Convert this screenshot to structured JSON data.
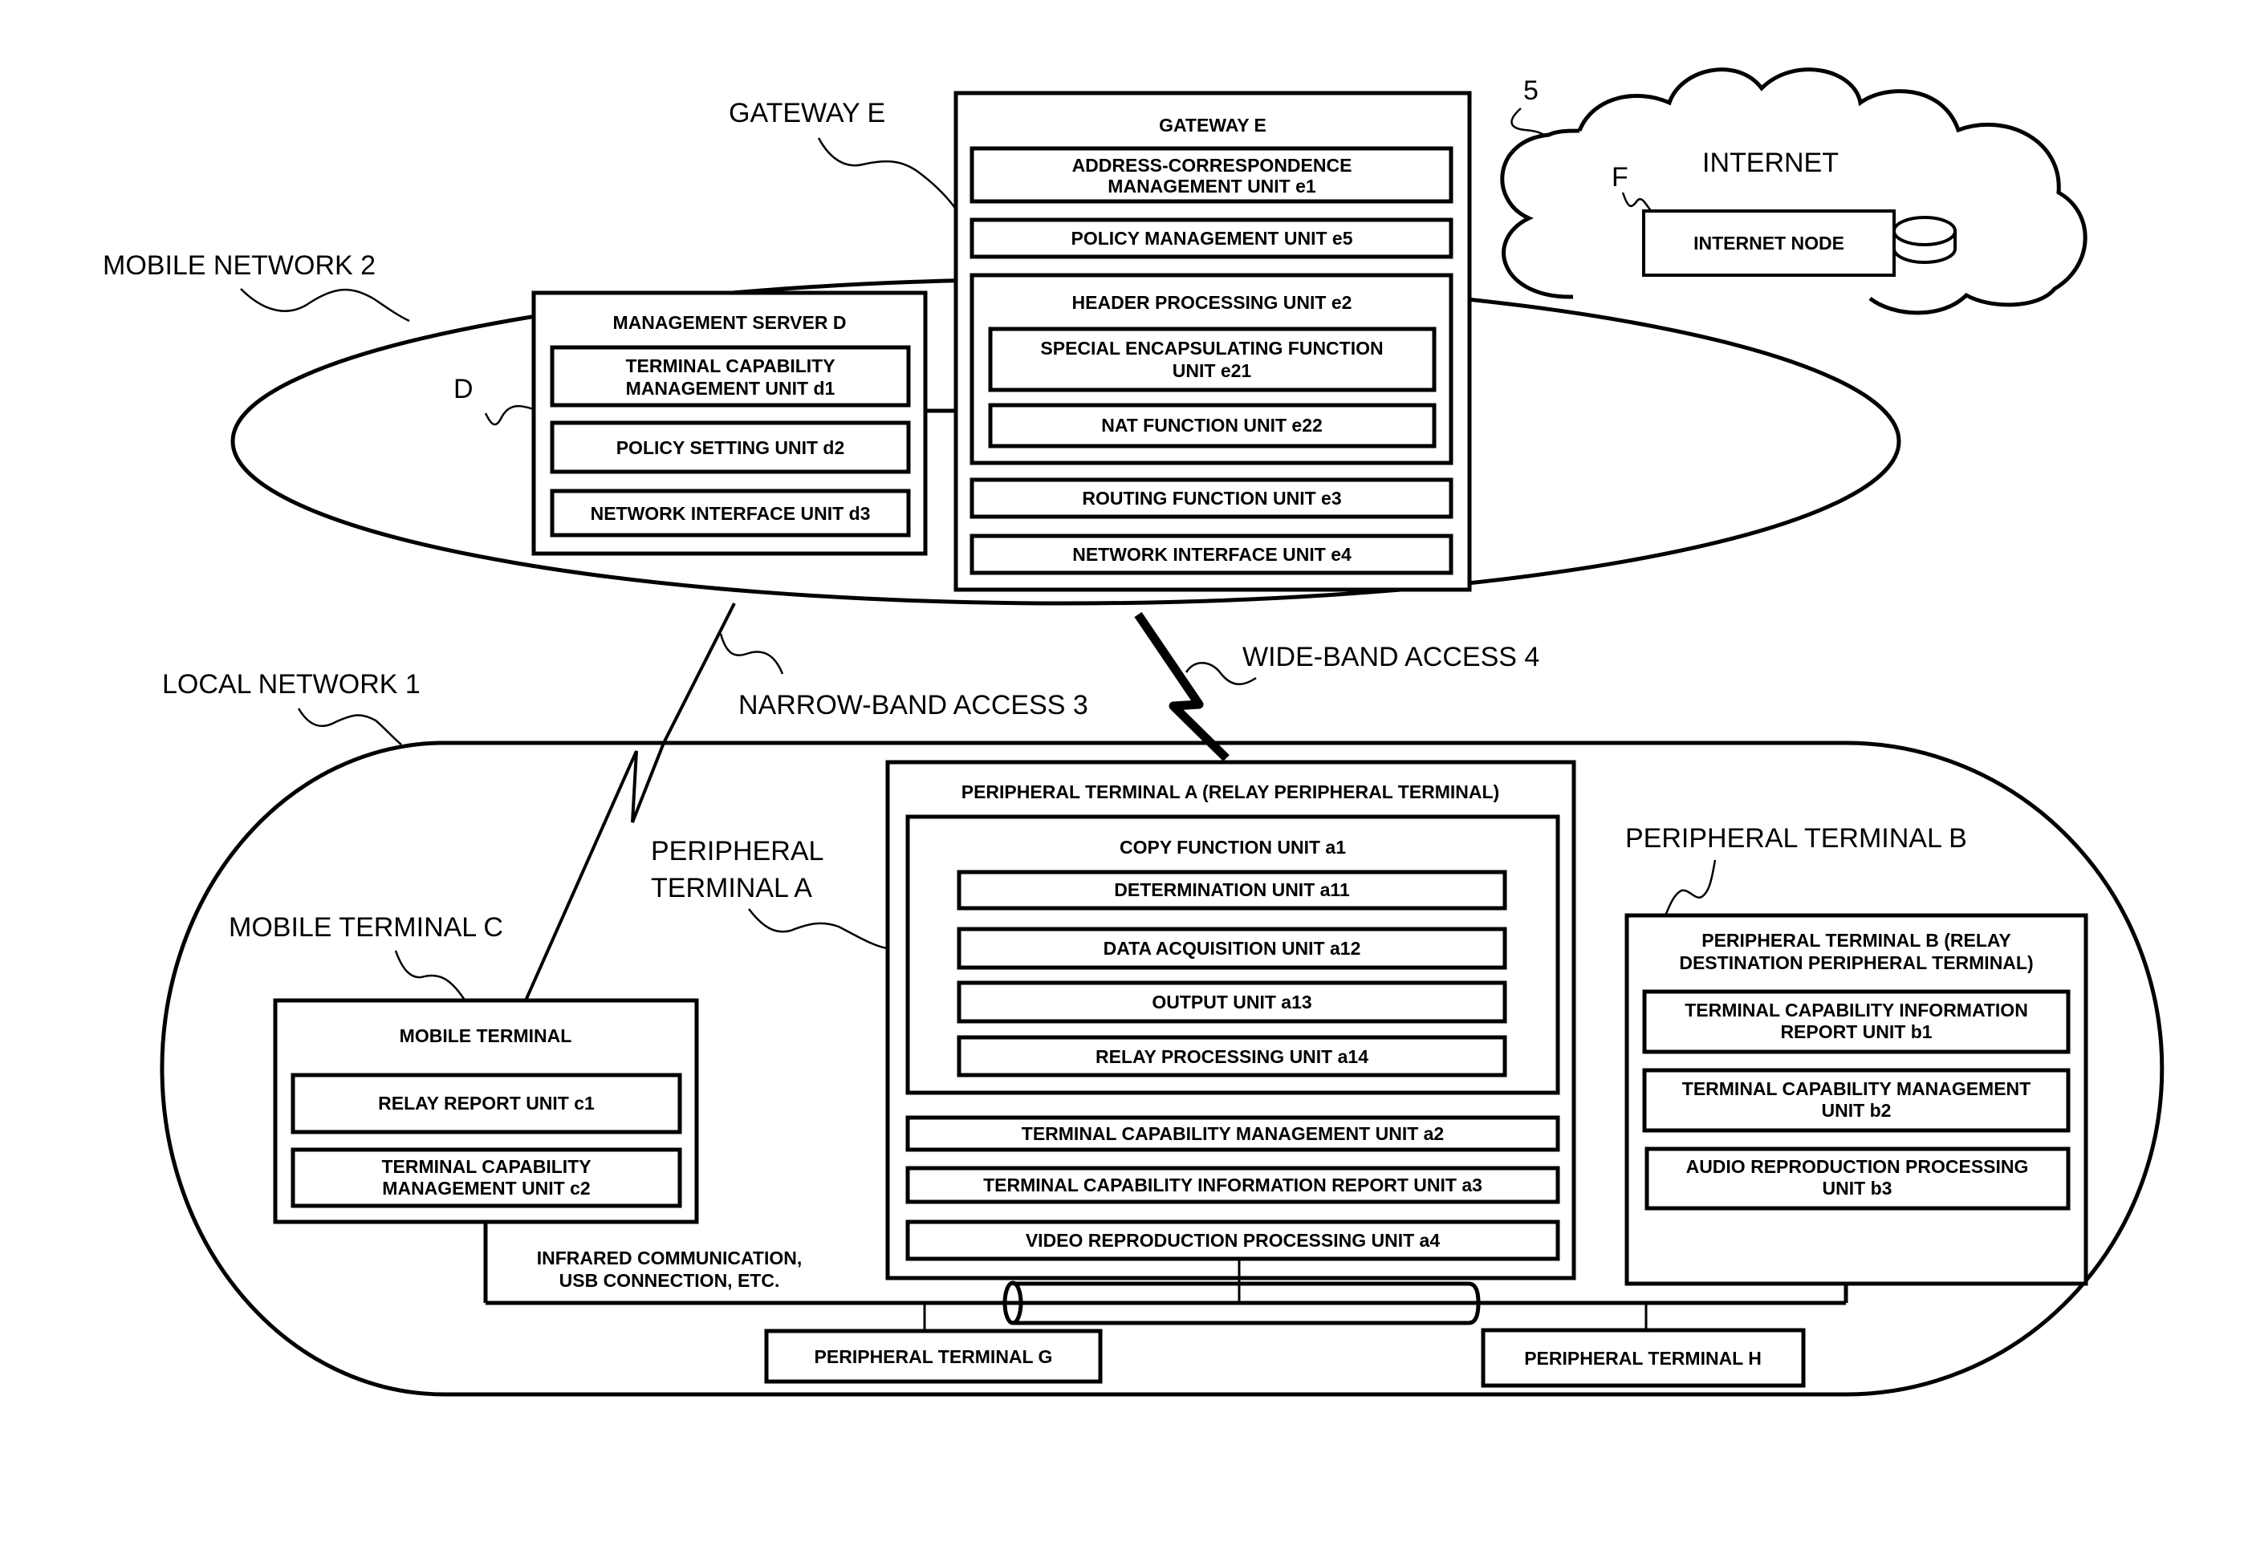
{
  "figure": {
    "networks": {
      "mobile_network": "MOBILE NETWORK  2",
      "local_network": "LOCAL NETWORK  1",
      "internet": "INTERNET",
      "internet_ref": "5"
    },
    "access": {
      "narrow_band": "NARROW-BAND ACCESS  3",
      "wide_band": "WIDE-BAND ACCESS  4"
    },
    "callouts": {
      "gateway": "GATEWAY E",
      "management_server": "D",
      "internet_node": "F",
      "mobile_terminal": "MOBILE TERMINAL  C",
      "peripheral_a_line1": "PERIPHERAL",
      "peripheral_a_line2": "TERMINAL  A",
      "peripheral_b": "PERIPHERAL TERMINAL  B"
    },
    "gateway": {
      "title": "GATEWAY  E",
      "units": {
        "e1_line1": "ADDRESS-CORRESPONDENCE",
        "e1_line2": "MANAGEMENT UNIT  e1",
        "e5": "POLICY MANAGEMENT UNIT  e5",
        "e2": "HEADER PROCESSING UNIT  e2",
        "e21_line1": "SPECIAL ENCAPSULATING FUNCTION",
        "e21_line2": "UNIT  e21",
        "e22": "NAT FUNCTION UNIT  e22",
        "e3": "ROUTING FUNCTION UNIT  e3",
        "e4": "NETWORK INTERFACE UNIT  e4"
      }
    },
    "management_server": {
      "title": "MANAGEMENT SERVER D",
      "units": {
        "d1_line1": "TERMINAL CAPABILITY",
        "d1_line2": "MANAGEMENT UNIT  d1",
        "d2": "POLICY SETTING UNIT  d2",
        "d3": "NETWORK INTERFACE UNIT  d3"
      }
    },
    "internet_node": {
      "label": "INTERNET NODE"
    },
    "mobile_terminal": {
      "title": "MOBILE TERMINAL",
      "units": {
        "c1": "RELAY REPORT UNIT  c1",
        "c2_line1": "TERMINAL CAPABILITY",
        "c2_line2": "MANAGEMENT UNIT  c2"
      }
    },
    "peripheral_a": {
      "title": "PERIPHERAL TERMINAL A  (RELAY PERIPHERAL TERMINAL)",
      "copy_function": {
        "title": "COPY FUNCTION UNIT  a1",
        "a11": "DETERMINATION UNIT  a11",
        "a12": "DATA ACQUISITION UNIT  a12",
        "a13": "OUTPUT UNIT  a13",
        "a14": "RELAY PROCESSING UNIT  a14"
      },
      "a2": "TERMINAL CAPABILITY MANAGEMENT UNIT  a2",
      "a3": "TERMINAL CAPABILITY INFORMATION REPORT UNIT  a3",
      "a4": "VIDEO REPRODUCTION PROCESSING UNIT  a4"
    },
    "peripheral_b": {
      "title_line1": "PERIPHERAL TERMINAL B (RELAY",
      "title_line2": "DESTINATION PERIPHERAL TERMINAL)",
      "units": {
        "b1_line1": "TERMINAL CAPABILITY INFORMATION",
        "b1_line2": "REPORT UNIT b1",
        "b2_line1": "TERMINAL CAPABILITY MANAGEMENT",
        "b2_line2": "UNIT  b2",
        "b3_line1": "AUDIO REPRODUCTION PROCESSING",
        "b3_line2": "UNIT  b3"
      }
    },
    "local_bus": {
      "line1": "INFRARED COMMUNICATION,",
      "line2": "USB CONNECTION, ETC."
    },
    "peripheral_g": "PERIPHERAL TERMINAL  G",
    "peripheral_h": "PERIPHERAL TERMINAL  H"
  }
}
